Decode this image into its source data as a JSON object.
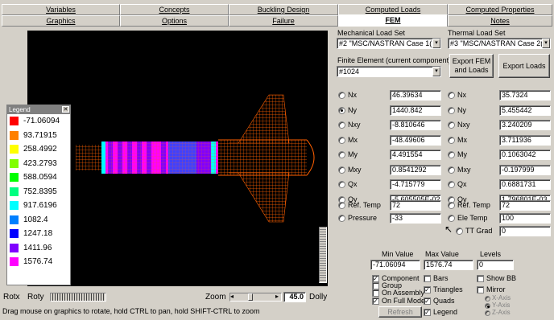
{
  "tabs_top": [
    "Variables",
    "Concepts",
    "Buckling Design",
    "Computed Loads",
    "Computed Properties"
  ],
  "tabs_bottom": [
    "Graphics",
    "Options",
    "Failure",
    "FEM",
    "Notes"
  ],
  "mech_load_set": {
    "label": "Mechanical Load Set",
    "value": "#2 \"MSC/NASTRAN Case 1("
  },
  "therm_load_set": {
    "label": "Thermal Load Set",
    "value": "#3 \"MSC/NASTRAN Case 2("
  },
  "finite_element": {
    "label": "Finite Element (current component)",
    "value": "#1024"
  },
  "buttons": {
    "export_fem": "Export FEM and Loads",
    "export_loads": "Export Loads",
    "refresh": "Refresh"
  },
  "mech_rows": [
    {
      "label": "Nx",
      "value": "46.39634",
      "selected": false
    },
    {
      "label": "Ny",
      "value": "1440.842",
      "selected": true
    },
    {
      "label": "Nxy",
      "value": "-8.810646",
      "selected": false
    },
    {
      "label": "Mx",
      "value": "-48.49606",
      "selected": false
    },
    {
      "label": "My",
      "value": "4.491554",
      "selected": false
    },
    {
      "label": "Mxy",
      "value": "0.8541292",
      "selected": false
    },
    {
      "label": "Qx",
      "value": "-4.715779",
      "selected": false
    },
    {
      "label": "Qy",
      "value": "-5.605505E-02",
      "selected": false
    }
  ],
  "therm_rows": [
    {
      "label": "Nx",
      "value": "35.7324"
    },
    {
      "label": "Ny",
      "value": "5.455442"
    },
    {
      "label": "Nxy",
      "value": "3.240209"
    },
    {
      "label": "Mx",
      "value": "3.711936"
    },
    {
      "label": "My",
      "value": "0.1063042"
    },
    {
      "label": "Mxy",
      "value": "-0.197999"
    },
    {
      "label": "Qx",
      "value": "0.6881731"
    },
    {
      "label": "Qy",
      "value": "1.796801E-03"
    }
  ],
  "ref_temp": {
    "label": "Ref. Temp",
    "value": "72"
  },
  "pressure": {
    "label": "Pressure",
    "value": "-33"
  },
  "ref_temp2": {
    "label": "Ref. Temp",
    "value": "72"
  },
  "ele_temp": {
    "label": "Ele Temp",
    "value": "100"
  },
  "tt_grad": {
    "label": "TT Grad",
    "value": "0"
  },
  "range": {
    "min_label": "Min Value",
    "min": "-71.06094",
    "max_label": "Max Value",
    "max": "1576.74",
    "levels_label": "Levels",
    "levels": "0"
  },
  "options_left": [
    {
      "label": "Component",
      "checked": true,
      "type": "check"
    },
    {
      "label": "Group",
      "checked": false,
      "type": "check"
    },
    {
      "label": "On Assembly",
      "checked": false,
      "type": "check"
    },
    {
      "label": "On Full Model",
      "checked": true,
      "type": "check"
    }
  ],
  "options_mid": [
    {
      "label": "Bars",
      "checked": false
    },
    {
      "label": "Triangles",
      "checked": true
    },
    {
      "label": "Quads",
      "checked": true
    },
    {
      "label": "Legend",
      "checked": true
    }
  ],
  "options_right": [
    {
      "label": "Show BB",
      "checked": false
    },
    {
      "label": "Mirror",
      "checked": false
    }
  ],
  "axes": [
    "X-Axis",
    "Y-Axis",
    "Z-Axis"
  ],
  "legend": {
    "title": "Legend",
    "items": [
      {
        "value": "-71.06094",
        "color": "#ff0000"
      },
      {
        "value": "93.71915",
        "color": "#ff8000"
      },
      {
        "value": "258.4992",
        "color": "#ffff00"
      },
      {
        "value": "423.2793",
        "color": "#80ff00"
      },
      {
        "value": "588.0594",
        "color": "#00ff00"
      },
      {
        "value": "752.8395",
        "color": "#00ff80"
      },
      {
        "value": "917.6196",
        "color": "#00ffff"
      },
      {
        "value": "1082.4",
        "color": "#0080ff"
      },
      {
        "value": "1247.18",
        "color": "#0000ff"
      },
      {
        "value": "1411.96",
        "color": "#8000ff"
      },
      {
        "value": "1576.74",
        "color": "#ff00ff"
      }
    ]
  },
  "bottom": {
    "rotx": "Rotx",
    "roty": "Roty",
    "zoom_label": "Zoom",
    "zoom_value": "45.0",
    "dolly": "Dolly"
  },
  "status": "Drag mouse on graphics to rotate, hold CTRL to pan, hold SHIFT-CTRL to zoom"
}
